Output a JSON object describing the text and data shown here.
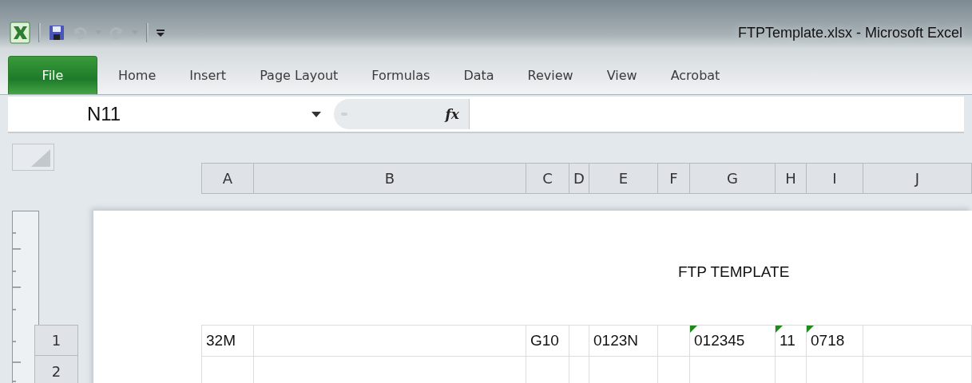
{
  "window": {
    "title": "FTPTemplate.xlsx  -  Microsoft Excel"
  },
  "ribbon_tabs": [
    {
      "label": "File",
      "kind": "file"
    },
    {
      "label": "Home",
      "kind": "tab"
    },
    {
      "label": "Insert",
      "kind": "tab"
    },
    {
      "label": "Page Layout",
      "kind": "tab"
    },
    {
      "label": "Formulas",
      "kind": "tab"
    },
    {
      "label": "Data",
      "kind": "tab"
    },
    {
      "label": "Review",
      "kind": "tab"
    },
    {
      "label": "View",
      "kind": "tab"
    },
    {
      "label": "Acrobat",
      "kind": "tab"
    }
  ],
  "formula_bar": {
    "name_box": "N11",
    "function_label": "fx"
  },
  "sheet": {
    "columns": [
      "A",
      "B",
      "C",
      "D",
      "E",
      "F",
      "G",
      "H",
      "I",
      "J"
    ],
    "page_title": "FTP TEMPLATE",
    "rows": [
      {
        "header": "1",
        "cells": [
          {
            "text": "32M",
            "flag": false
          },
          null,
          {
            "text": "G10",
            "flag": false
          },
          null,
          {
            "text": "0123N",
            "flag": false
          },
          null,
          {
            "text": "012345",
            "flag": true
          },
          {
            "text": "11",
            "flag": true
          },
          {
            "text": "0718",
            "flag": true
          },
          null
        ]
      },
      {
        "header": "2"
      }
    ]
  }
}
